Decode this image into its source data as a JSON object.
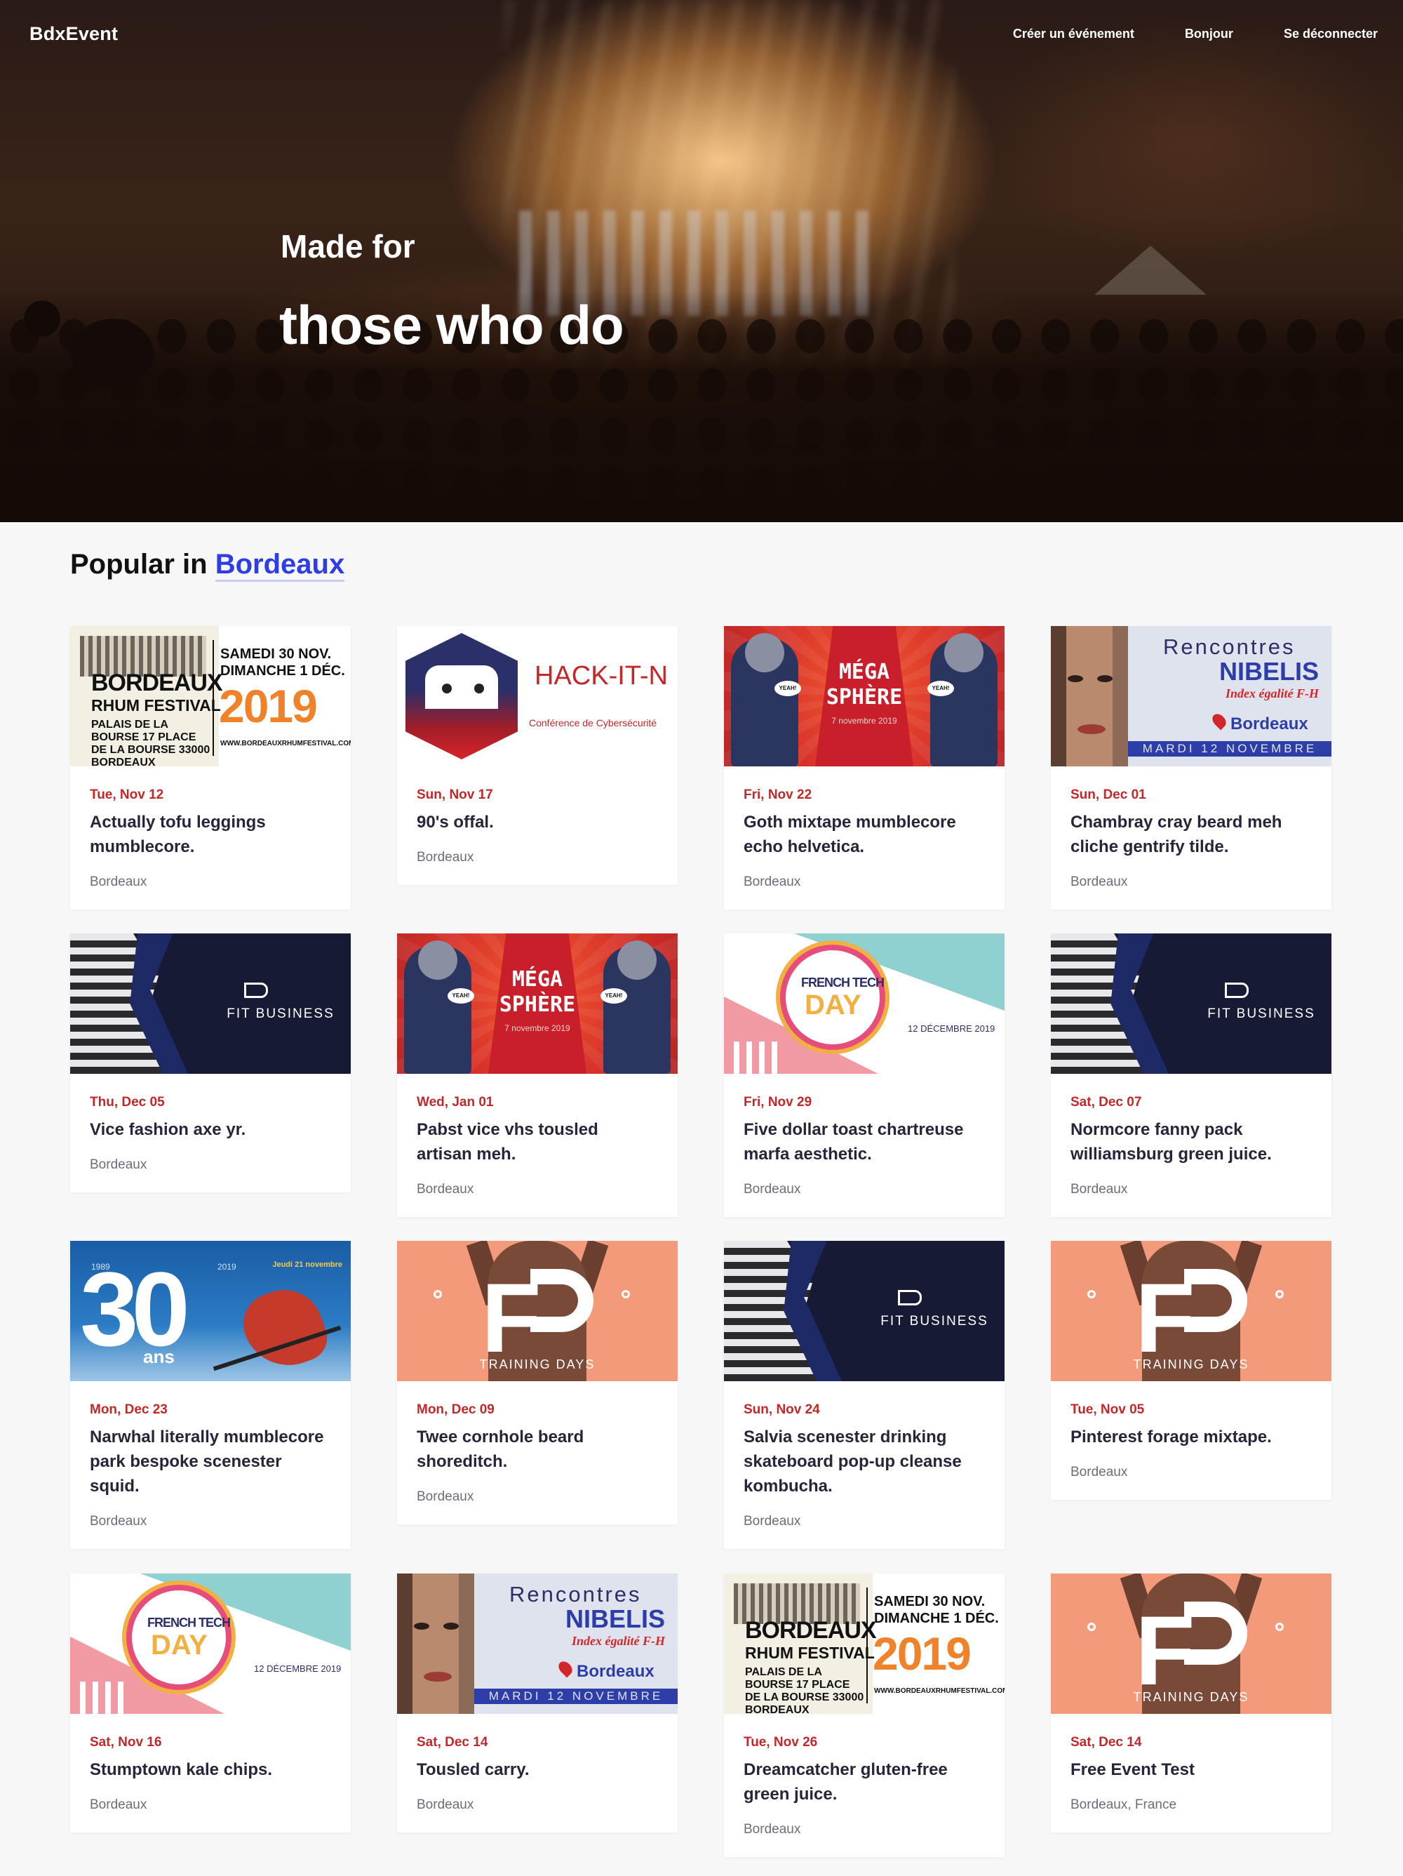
{
  "nav": {
    "brand": "BdxEvent",
    "links": [
      "Créer un événement",
      "Bonjour",
      "Se déconnecter"
    ]
  },
  "hero": {
    "line1": "Made for",
    "line2": "those who do"
  },
  "section": {
    "prefix": "Popular in",
    "city": "Bordeaux"
  },
  "thumb_text": {
    "rhum": {
      "l1": "BORDEAUX",
      "l2": "RHUM FESTIVAL",
      "l3": "PALAIS DE LA BOURSE 17 PLACE DE LA BOURSE 33000 BORDEAUX",
      "r1": "SAMEDI 30 NOV.",
      "r2": "DIMANCHE 1 DÉC.",
      "year": "2019",
      "url": "WWW.BORDEAUXRHUMFESTIVAL.COM"
    },
    "hack": {
      "title": "HACK-IT-N",
      "sub": "Conférence de Cybersécurité"
    },
    "mega": {
      "l1": "MÉGA",
      "l2": "SPHÈRE",
      "l3": "7 novembre 2019",
      "yeah": "YEAH!"
    },
    "nibelis": {
      "l1": "Rencontres",
      "l2": "NIBELIS",
      "l3": "Index égalité F-H",
      "city": "Bordeaux",
      "date": "MARDI 12 NOVEMBRE"
    },
    "fit": {
      "label": "FIT BUSINESS"
    },
    "frenchtech": {
      "l1": "FRENCH TECH",
      "l2": "DAY",
      "date": "12 DÉCEMBRE 2019"
    },
    "thirty": {
      "num": "30",
      "ans": "ans",
      "y1": "1989",
      "y2": "2019",
      "jd": "Jeudi 21 novembre"
    },
    "training": {
      "label": "TRAINING DAYS"
    }
  },
  "events": [
    {
      "thumb": "rhum",
      "date": "Tue, Nov 12",
      "title": "Actually tofu leggings mumblecore.",
      "place": "Bordeaux"
    },
    {
      "thumb": "hack",
      "date": "Sun, Nov 17",
      "title": "90's offal.",
      "place": "Bordeaux"
    },
    {
      "thumb": "mega",
      "date": "Fri, Nov 22",
      "title": "Goth mixtape mumblecore echo helvetica.",
      "place": "Bordeaux"
    },
    {
      "thumb": "nibelis",
      "date": "Sun, Dec 01",
      "title": "Chambray cray beard meh cliche gentrify tilde.",
      "place": "Bordeaux"
    },
    {
      "thumb": "fit",
      "date": "Thu, Dec 05",
      "title": "Vice fashion axe yr.",
      "place": "Bordeaux"
    },
    {
      "thumb": "mega",
      "date": "Wed, Jan 01",
      "title": "Pabst vice vhs tousled artisan meh.",
      "place": "Bordeaux"
    },
    {
      "thumb": "frenchtech",
      "date": "Fri, Nov 29",
      "title": "Five dollar toast chartreuse marfa aesthetic.",
      "place": "Bordeaux"
    },
    {
      "thumb": "fit",
      "date": "Sat, Dec 07",
      "title": "Normcore fanny pack williamsburg green juice.",
      "place": "Bordeaux"
    },
    {
      "thumb": "thirty",
      "date": "Mon, Dec 23",
      "title": "Narwhal literally mumblecore park bespoke scenester squid.",
      "place": "Bordeaux"
    },
    {
      "thumb": "training",
      "date": "Mon, Dec 09",
      "title": "Twee cornhole beard shoreditch.",
      "place": "Bordeaux"
    },
    {
      "thumb": "fit",
      "date": "Sun, Nov 24",
      "title": "Salvia scenester drinking skateboard pop-up cleanse kombucha.",
      "place": "Bordeaux"
    },
    {
      "thumb": "training",
      "date": "Tue, Nov 05",
      "title": "Pinterest forage mixtape.",
      "place": "Bordeaux"
    },
    {
      "thumb": "frenchtech",
      "date": "Sat, Nov 16",
      "title": "Stumptown kale chips.",
      "place": "Bordeaux"
    },
    {
      "thumb": "nibelis",
      "date": "Sat, Dec 14",
      "title": "Tousled carry.",
      "place": "Bordeaux"
    },
    {
      "thumb": "rhum",
      "date": "Tue, Nov 26",
      "title": "Dreamcatcher gluten-free green juice.",
      "place": "Bordeaux"
    },
    {
      "thumb": "training",
      "date": "Sat, Dec 14",
      "title": "Free Event Test",
      "place": "Bordeaux, France"
    }
  ],
  "colors": {
    "accent": "#2d3ee6",
    "date": "#c2282a"
  }
}
